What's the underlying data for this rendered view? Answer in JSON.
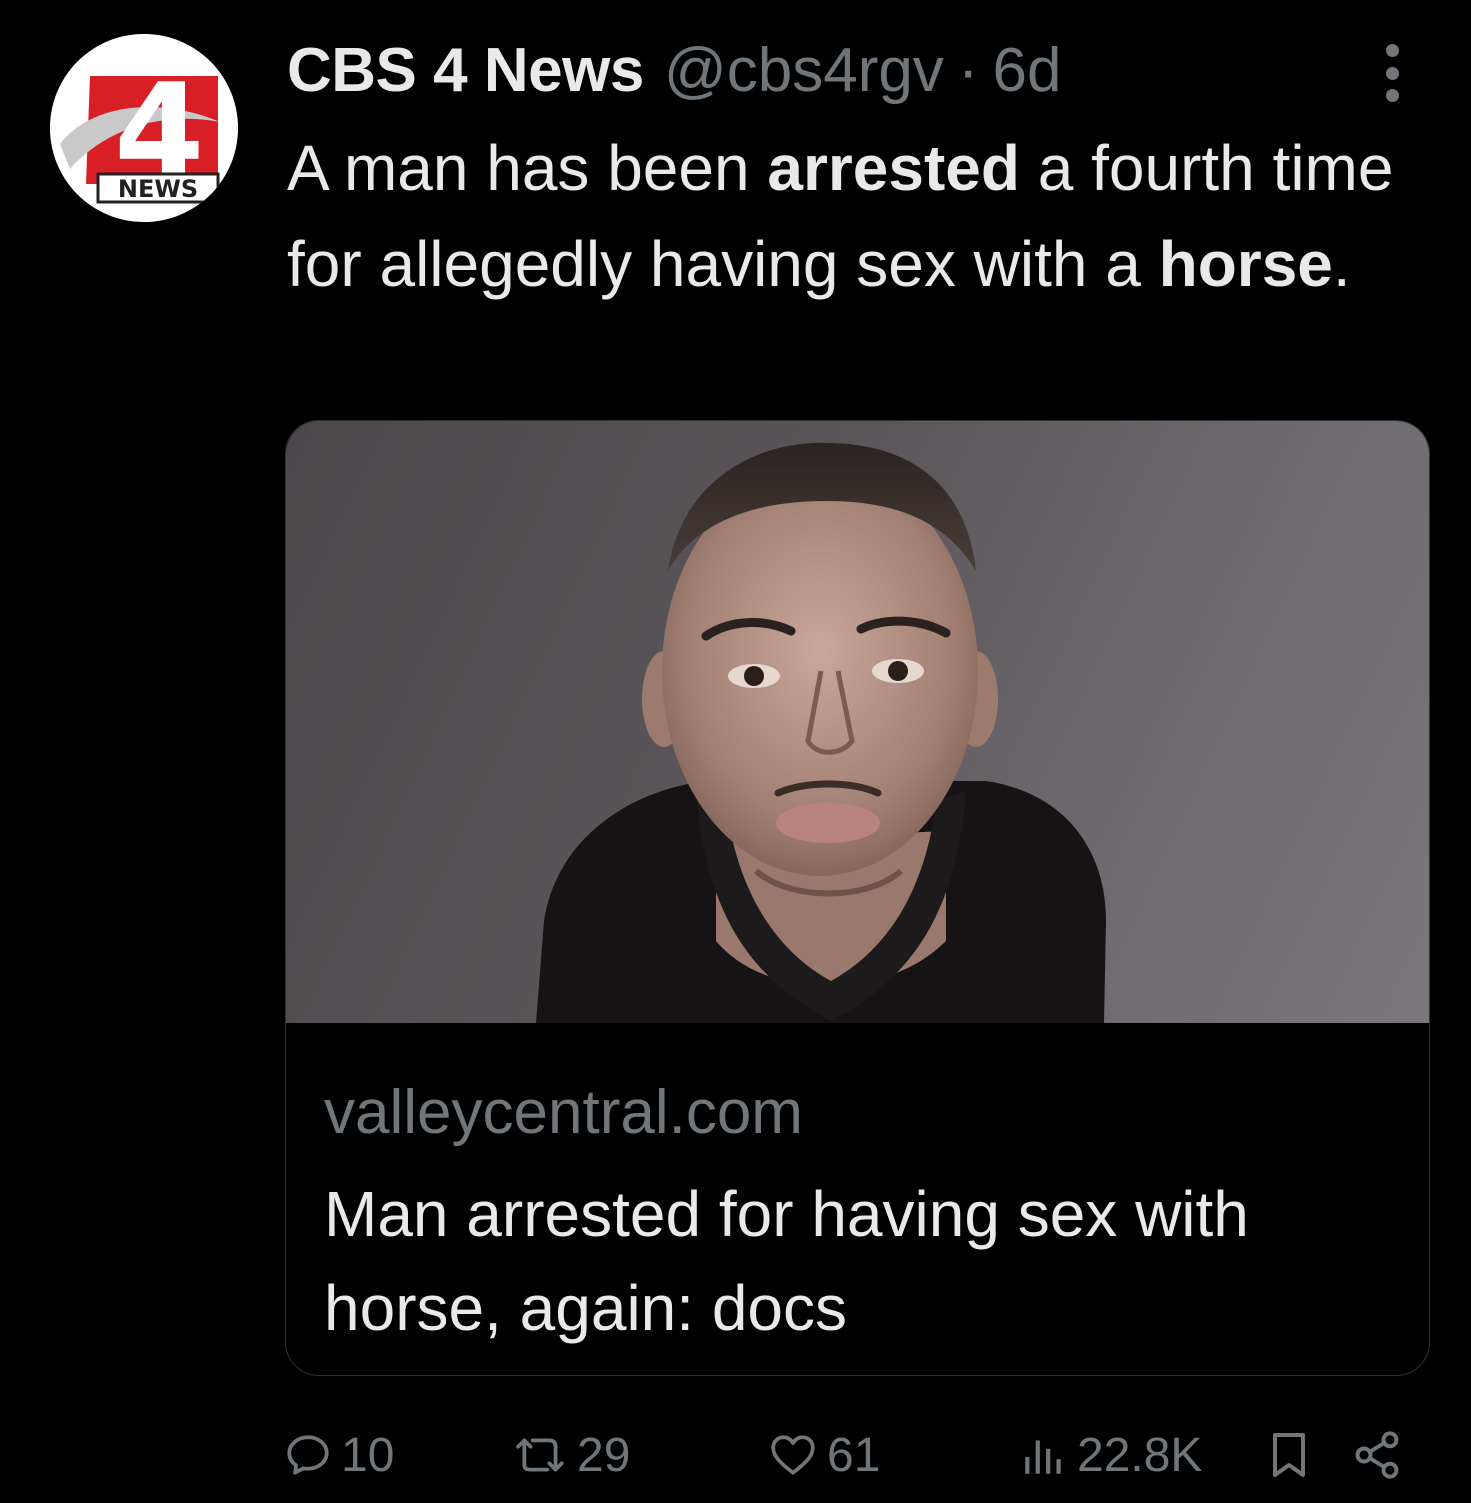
{
  "author": {
    "display_name": "CBS 4 News",
    "handle": "@cbs4rgv",
    "separator": "·",
    "time": "6d",
    "avatar_logo_number": "4",
    "avatar_logo_text": "NEWS"
  },
  "tweet": {
    "text_parts": {
      "p1": "A man has been ",
      "bold1": "arrested",
      "p2": " a fourth time for allegedly having sex with a ",
      "bold2": "horse",
      "p3": "."
    }
  },
  "card": {
    "domain": "valleycentral.com",
    "title": "Man arrested for having sex with horse, again: docs"
  },
  "actions": {
    "replies": "10",
    "retweets": "29",
    "likes": "61",
    "views": "22.8K"
  },
  "icons": {
    "reply": "reply-icon",
    "retweet": "retweet-icon",
    "like": "heart-icon",
    "views": "views-icon",
    "bookmark": "bookmark-icon",
    "share": "share-icon",
    "more": "more-icon"
  },
  "colors": {
    "background": "#000000",
    "text_primary": "#e7e9ea",
    "text_secondary": "#71767b",
    "border": "#2f3336",
    "brand_red": "#d91f26"
  }
}
